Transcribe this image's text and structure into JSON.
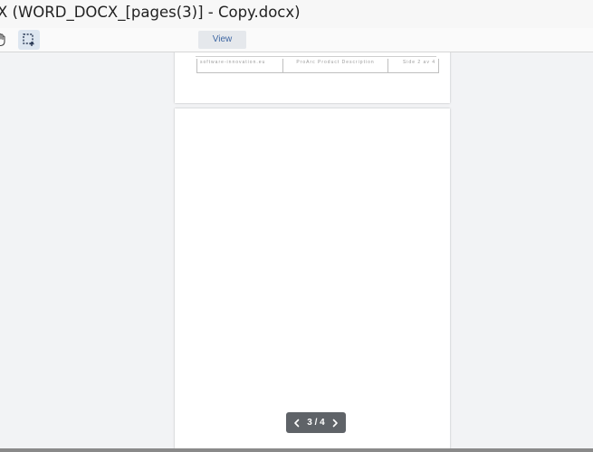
{
  "window": {
    "title": "X (WORD_DOCX_[pages(3)] - Copy.docx)"
  },
  "toolbar": {
    "hand_tool_icon": "hand-icon",
    "select_tool_icon": "marquee-select-icon",
    "view_label": "View"
  },
  "document": {
    "footer": {
      "left": "software-innovation.eu",
      "center": "ProArc Product Description",
      "right": "Side 2 av 4"
    }
  },
  "pager": {
    "label": "3 / 4",
    "prev_icon": "chevron-left-icon",
    "next_icon": "chevron-right-icon",
    "bg_color": "#5f6368"
  },
  "colors": {
    "viewer_bg": "#f2f3f5",
    "accent": "#3f67a3",
    "active_tool_bg": "#dde6f0"
  }
}
